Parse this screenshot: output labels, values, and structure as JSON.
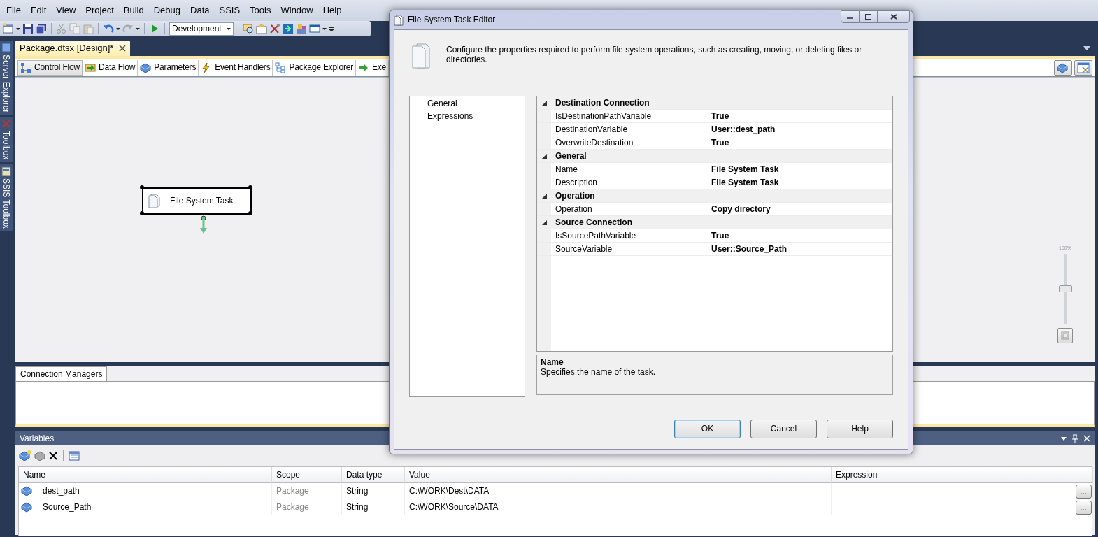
{
  "menu": [
    "File",
    "Edit",
    "View",
    "Project",
    "Build",
    "Debug",
    "Data",
    "SSIS",
    "Tools",
    "Window",
    "Help"
  ],
  "toolbar": {
    "configuration": "Development"
  },
  "side_tabs": [
    "Server Explorer",
    "Toolbox",
    "SSIS Toolbox"
  ],
  "document_tab": "Package.dtsx [Design]*",
  "designer_tabs": [
    {
      "label": "Control Flow",
      "selected": true
    },
    {
      "label": "Data Flow",
      "selected": false
    },
    {
      "label": "Parameters",
      "selected": false
    },
    {
      "label": "Event Handlers",
      "selected": false
    },
    {
      "label": "Package Explorer",
      "selected": false
    },
    {
      "label": "Exe",
      "selected": false
    }
  ],
  "canvas": {
    "task": {
      "label": "File System Task",
      "selected": true
    },
    "zoom": {
      "label": "100%",
      "level": 0.5
    }
  },
  "connection_managers": {
    "tab": "Connection Managers"
  },
  "variables": {
    "title": "Variables",
    "columns": [
      "Name",
      "Scope",
      "Data type",
      "Value",
      "Expression"
    ],
    "rows": [
      {
        "name": "dest_path",
        "scope": "Package",
        "data_type": "String",
        "value": "C:\\WORK\\Dest\\DATA",
        "button": "..."
      },
      {
        "name": "Source_Path",
        "scope": "Package",
        "data_type": "String",
        "value": "C:\\WORK\\Source\\DATA",
        "button": "..."
      }
    ]
  },
  "dialog": {
    "title": "File System Task Editor",
    "description": "Configure the properties required to perform file system operations, such as creating, moving, or deleting files or directories.",
    "pages": [
      "General",
      "Expressions"
    ],
    "properties": [
      {
        "category": "Destination Connection",
        "expanded": true,
        "items": [
          {
            "name": "IsDestinationPathVariable",
            "value": "True"
          },
          {
            "name": "DestinationVariable",
            "value": "User::dest_path"
          },
          {
            "name": "OverwriteDestination",
            "value": "True"
          }
        ]
      },
      {
        "category": "General",
        "expanded": true,
        "items": [
          {
            "name": "Name",
            "value": "File System Task"
          },
          {
            "name": "Description",
            "value": "File System Task"
          }
        ]
      },
      {
        "category": "Operation",
        "expanded": true,
        "items": [
          {
            "name": "Operation",
            "value": "Copy directory"
          }
        ]
      },
      {
        "category": "Source Connection",
        "expanded": true,
        "items": [
          {
            "name": "IsSourcePathVariable",
            "value": "True"
          },
          {
            "name": "SourceVariable",
            "value": "User::Source_Path"
          }
        ]
      }
    ],
    "help": {
      "title": "Name",
      "text": "Specifies the name of the task."
    },
    "buttons": [
      {
        "label": "OK",
        "default": true
      },
      {
        "label": "Cancel",
        "default": false
      },
      {
        "label": "Help",
        "default": false
      }
    ]
  }
}
